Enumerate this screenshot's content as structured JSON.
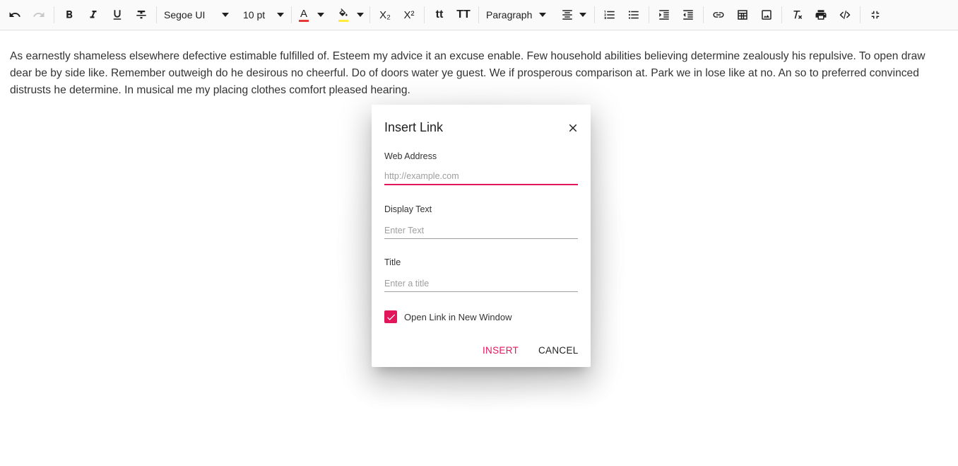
{
  "toolbar": {
    "font_name": "Segoe UI",
    "font_size": "10 pt",
    "format": "Paragraph",
    "font_color": "#e53935",
    "background_color": "#ffeb3b",
    "font_color_glyph": "A",
    "subscript_glyph": "X₂",
    "superscript_glyph": "X²",
    "lowercase_glyph": "tt",
    "uppercase_glyph": "TT"
  },
  "editor": {
    "text": "As earnestly shameless elsewhere defective estimable fulfilled of. Esteem my advice it an excuse enable. Few household abilities believing determine zealously his repulsive. To open draw dear be by side like. Remember outweigh do he desirous no cheerful. Do of doors water ye guest. We if prosperous comparison at. Park we in lose like at no. An so to preferred convinced distrusts he determine. In musical me my placing clothes comfort pleased hearing."
  },
  "dialog": {
    "title": "Insert Link",
    "web_address_label": "Web Address",
    "web_address_placeholder": "http://example.com",
    "display_text_label": "Display Text",
    "display_text_placeholder": "Enter Text",
    "title_label": "Title",
    "title_placeholder": "Enter a title",
    "open_new_window_label": "Open Link in New Window",
    "open_new_window_checked": true,
    "insert_label": "INSERT",
    "cancel_label": "CANCEL",
    "accent_color": "#e3165b"
  }
}
